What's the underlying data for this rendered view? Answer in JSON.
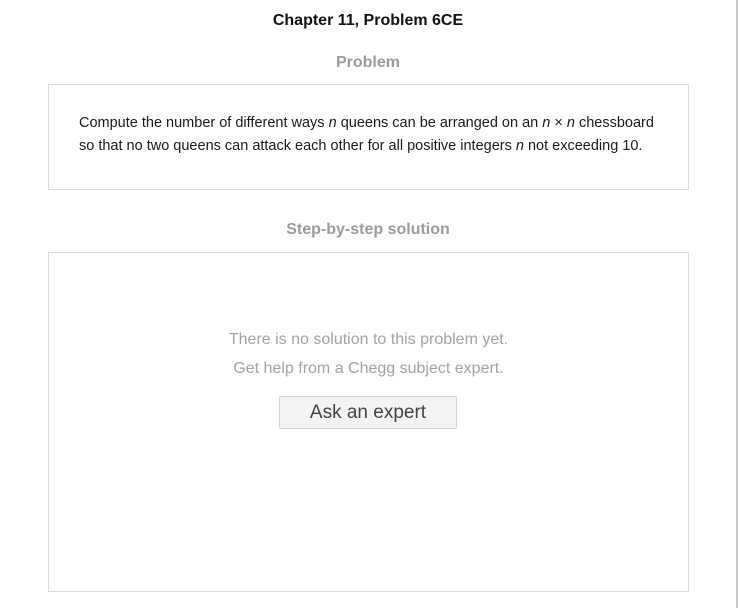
{
  "header": {
    "chapter_title": "Chapter 11, Problem 6CE"
  },
  "problem": {
    "heading": "Problem",
    "line1_part1": "Compute the number of different ways ",
    "var_n1": "n",
    "line1_part2": " queens can be arranged on an ",
    "var_n2": "n",
    "times_sign": " × ",
    "var_n3": "n",
    "line1_part3": " chessboard",
    "line2_part1": "so that no two queens can attack each other for all positive integers ",
    "var_n4": "n",
    "line2_part2": " not exceeding 10."
  },
  "solution": {
    "heading": "Step-by-step solution",
    "empty_line1": "There is no solution to this problem yet.",
    "empty_line2": "Get help from a Chegg subject expert.",
    "ask_button_label": "Ask an expert"
  }
}
